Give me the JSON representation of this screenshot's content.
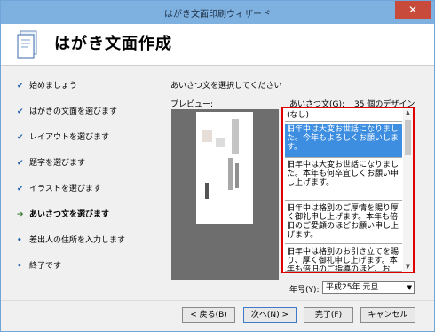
{
  "window": {
    "title": "はがき文面印刷ウィザード",
    "close_glyph": "✕"
  },
  "header": {
    "title": "はがき文面作成"
  },
  "nav": {
    "items": [
      {
        "mark": "✔",
        "label": "始めましょう"
      },
      {
        "mark": "✔",
        "label": "はがきの文面を選びます"
      },
      {
        "mark": "✔",
        "label": "レイアウトを選びます"
      },
      {
        "mark": "✔",
        "label": "題字を選びます"
      },
      {
        "mark": "✔",
        "label": "イラストを選びます"
      },
      {
        "mark": "➔",
        "label": "あいさつ文を選びます"
      },
      {
        "mark": "•",
        "label": "差出人の住所を入力します"
      },
      {
        "mark": "•",
        "label": "終了です"
      }
    ]
  },
  "main": {
    "instruction": "あいさつ文を選択してください",
    "preview_label": "プレビュー:",
    "list_label": "あいさつ文(G):",
    "count_label": "35 個のデザイン",
    "greetings": [
      "(なし)",
      "旧年中は大変お世話になりました。今年もよろしくお願いします。",
      "旧年中は大変お世話になりました。本年も何卒宜しくお願い申し上げます。",
      "旧年中は格別のご厚情を賜り厚く御礼申し上げます。本年も倍旧のご愛顧のほどお願い申し上げます。",
      "旧年中は格別のお引き立てを賜り、厚く御礼申し上げます。本年も倍旧のご指導のほど、お"
    ],
    "year_label": "年号(Y):",
    "year_value": "平成25年 元旦"
  },
  "buttons": {
    "back": "< 戻る(B)",
    "next": "次へ(N) >",
    "finish": "完了(F)",
    "cancel": "キャンセル"
  },
  "colors": {
    "titlebar": "#7fb1e0",
    "selection": "#3d8ee0",
    "highlight_border": "#e10000"
  }
}
